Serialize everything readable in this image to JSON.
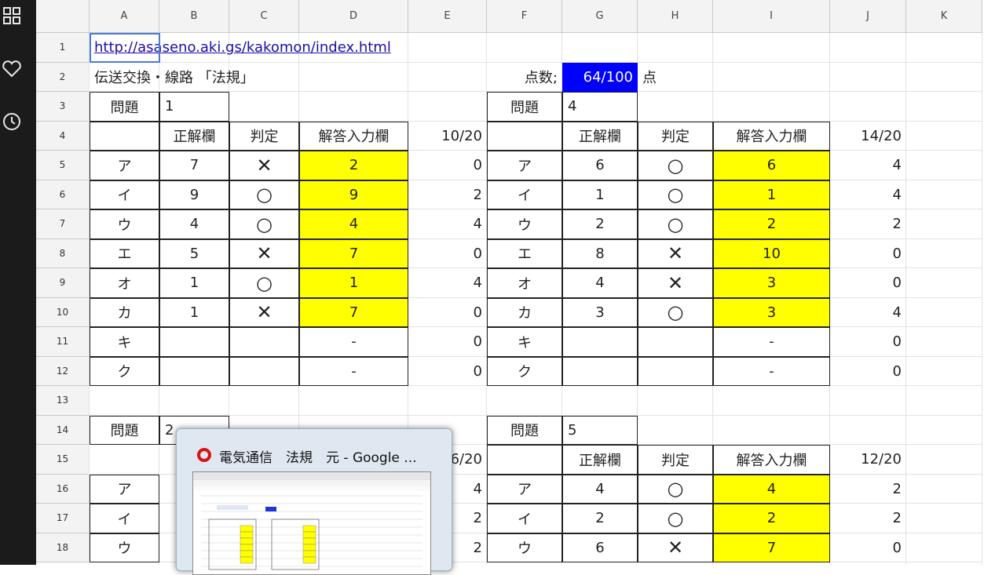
{
  "sidebar": {
    "icons": [
      "apps-grid-icon",
      "heart-icon",
      "clock-icon"
    ]
  },
  "columns": [
    "A",
    "B",
    "C",
    "D",
    "E",
    "F",
    "G",
    "H",
    "I",
    "J",
    "K"
  ],
  "rows": [
    "1",
    "2",
    "3",
    "4",
    "5",
    "6",
    "7",
    "8",
    "9",
    "10",
    "11",
    "12",
    "13",
    "14",
    "15",
    "16",
    "17",
    "18"
  ],
  "header": {
    "url": "http://asaseno.aki.gs/kakomon/index.html",
    "subject": "伝送交換・線路 「法規」",
    "score_label": "点数;",
    "score": "64/100",
    "score_unit": "点"
  },
  "labels": {
    "question": "問題",
    "answer": "正解欄",
    "judge": "判定",
    "input": "解答入力欄"
  },
  "q1": {
    "num": "1",
    "total": "10/20",
    "rows": [
      {
        "k": "ア",
        "ans": "7",
        "judge": "✕",
        "input": "2",
        "pts": "0"
      },
      {
        "k": "イ",
        "ans": "9",
        "judge": "○",
        "input": "9",
        "pts": "2"
      },
      {
        "k": "ウ",
        "ans": "4",
        "judge": "○",
        "input": "4",
        "pts": "4"
      },
      {
        "k": "エ",
        "ans": "5",
        "judge": "✕",
        "input": "7",
        "pts": "0"
      },
      {
        "k": "オ",
        "ans": "1",
        "judge": "○",
        "input": "1",
        "pts": "4"
      },
      {
        "k": "カ",
        "ans": "1",
        "judge": "✕",
        "input": "7",
        "pts": "0"
      },
      {
        "k": "キ",
        "ans": "",
        "judge": "",
        "input": "-",
        "pts": "0"
      },
      {
        "k": "ク",
        "ans": "",
        "judge": "",
        "input": "-",
        "pts": "0"
      }
    ]
  },
  "q4": {
    "num": "4",
    "total": "14/20",
    "rows": [
      {
        "k": "ア",
        "ans": "6",
        "judge": "○",
        "input": "6",
        "pts": "4"
      },
      {
        "k": "イ",
        "ans": "1",
        "judge": "○",
        "input": "1",
        "pts": "4"
      },
      {
        "k": "ウ",
        "ans": "2",
        "judge": "○",
        "input": "2",
        "pts": "2"
      },
      {
        "k": "エ",
        "ans": "8",
        "judge": "✕",
        "input": "10",
        "pts": "0"
      },
      {
        "k": "オ",
        "ans": "4",
        "judge": "✕",
        "input": "3",
        "pts": "0"
      },
      {
        "k": "カ",
        "ans": "3",
        "judge": "○",
        "input": "3",
        "pts": "4"
      },
      {
        "k": "キ",
        "ans": "",
        "judge": "",
        "input": "-",
        "pts": "0"
      },
      {
        "k": "ク",
        "ans": "",
        "judge": "",
        "input": "-",
        "pts": "0"
      }
    ]
  },
  "q2": {
    "num": "2",
    "total_partial": "6/20",
    "rows": [
      {
        "k": "ア",
        "pts": "4"
      },
      {
        "k": "イ",
        "pts": "2"
      },
      {
        "k": "ウ",
        "pts": "2"
      }
    ]
  },
  "q5": {
    "num": "5",
    "total": "12/20",
    "rows": [
      {
        "k": "ア",
        "ans": "4",
        "judge": "○",
        "input": "4",
        "pts": "2"
      },
      {
        "k": "イ",
        "ans": "2",
        "judge": "○",
        "input": "2",
        "pts": "2"
      },
      {
        "k": "ウ",
        "ans": "6",
        "judge": "✕",
        "input": "7",
        "pts": "0"
      }
    ]
  },
  "popup": {
    "title": "電気通信　法規　元 - Google ..."
  },
  "colors": {
    "input_fill": "#ffff00",
    "score_fill": "#0000ff",
    "link": "#1a0dab",
    "sidebar": "#1b1b1b"
  }
}
